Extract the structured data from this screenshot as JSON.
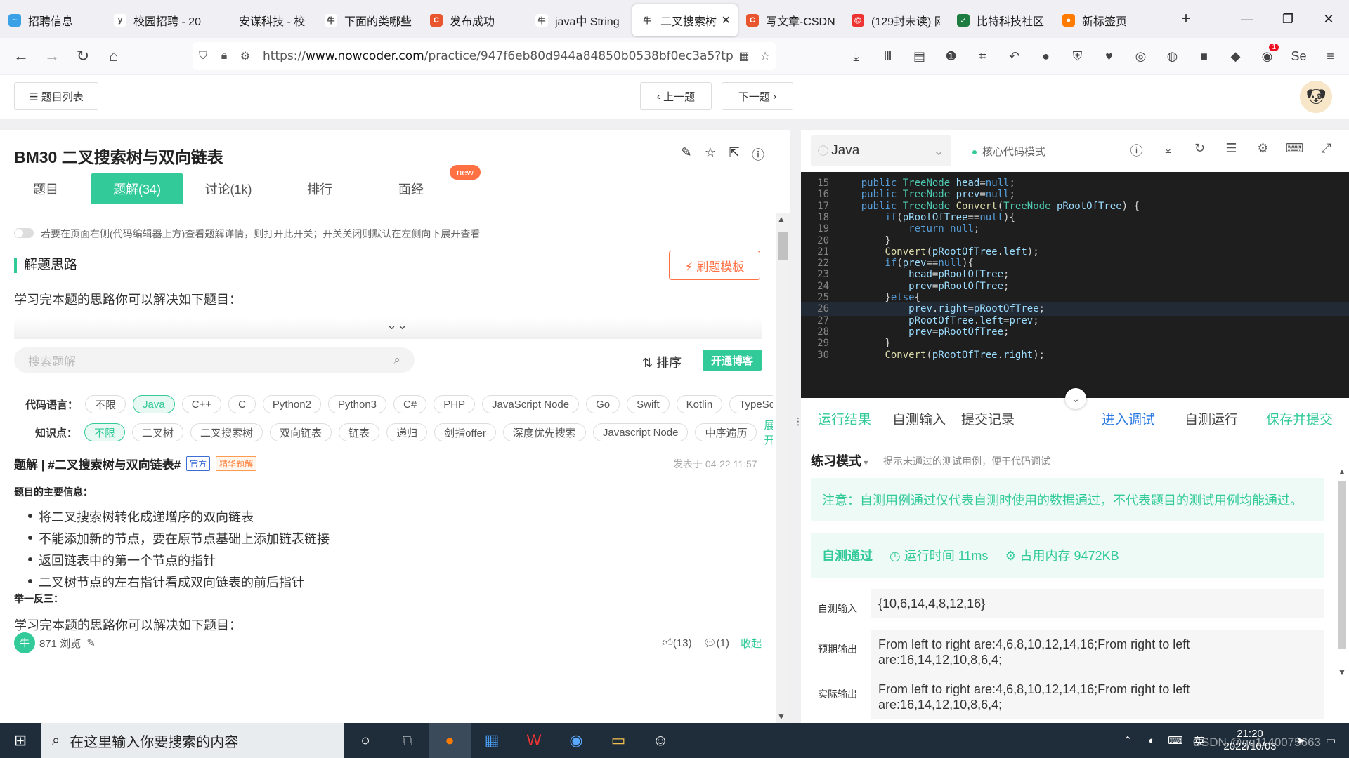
{
  "browser": {
    "tabs": [
      {
        "label": "招聘信息",
        "icon_color": "#3ba1e6",
        "icon": "~"
      },
      {
        "label": "校园招聘 - 20",
        "icon_color": "#ffffff",
        "icon": "y"
      },
      {
        "label": "安谋科技 - 校",
        "icon_color": "#f0f0f4",
        "icon": ""
      },
      {
        "label": "下面的类哪些",
        "icon_color": "#ffffff",
        "icon": "牛"
      },
      {
        "label": "发布成功",
        "icon_color": "#e8552e",
        "icon": "C"
      },
      {
        "label": "java中 String",
        "icon_color": "#ffffff",
        "icon": "牛"
      },
      {
        "label": "二叉搜索树",
        "icon_color": "#ffffff",
        "icon": "牛",
        "active": true
      },
      {
        "label": "写文章-CSDN",
        "icon_color": "#e8552e",
        "icon": "C"
      },
      {
        "label": "(129封未读) 网",
        "icon_color": "#e33",
        "icon": "@"
      },
      {
        "label": "比特科技社区",
        "icon_color": "#1d7c3f",
        "icon": "✓"
      },
      {
        "label": "新标签页",
        "icon_color": "#ff7a00",
        "icon": "●"
      }
    ],
    "new_tab_label": "+",
    "url_host": "www.nowcoder.com",
    "url_prefix": "https://",
    "url_path": "/practice/947f6eb80d944a84850b0538bf0ec3a5?tp"
  },
  "page_header": {
    "list_button": "☰ 题目列表",
    "prev_button": "上一题",
    "next_button": "下一题"
  },
  "problem": {
    "title": "BM30  二叉搜索树与双向链表",
    "tabs": [
      "题目",
      "题解(34)",
      "讨论(1k)",
      "排行",
      "面经"
    ],
    "new_badge": "new",
    "toggle_tip": "若要在页面右侧(代码编辑器上方)查看题解详情，则打开此开关；开关关闭则默认在左侧向下展开查看",
    "section_title": "解题思路",
    "template_button": "⚡ 刷题模板",
    "intro": "学习完本题的思路你可以解决如下题目：",
    "search_placeholder": "搜索题解",
    "sort_label": "⇅ 排序",
    "open_blog_button": "开通博客",
    "lang_label": "代码语言：",
    "langs": [
      "不限",
      "Java",
      "C++",
      "C",
      "Python2",
      "Python3",
      "C#",
      "PHP",
      "JavaScript Node",
      "Go",
      "Swift",
      "Kotlin",
      "TypeScript"
    ],
    "lang_selected": "Java",
    "topic_label": "知识点：",
    "topics": [
      "不限",
      "二叉树",
      "二叉搜索树",
      "双向链表",
      "链表",
      "递归",
      "剑指offer",
      "深度优先搜索",
      "Javascript Node",
      "中序遍历"
    ],
    "topic_selected": "不限",
    "expand_link": "展开",
    "solution_title": "题解 | #二叉搜索树与双向链表#",
    "tag_official": "官方",
    "tag_featured": "精华题解",
    "post_time": "发表于 04-22 11:57",
    "main_info_label": "题目的主要信息：",
    "bullets": [
      "将二叉搜索树转化成递增序的双向链表",
      "不能添加新的节点，要在原节点基础上添加链表链接",
      "返回链表中的第一个节点的指针",
      "二叉树节点的左右指针看成双向链表的前后指针"
    ],
    "infer_label": "举一反三：",
    "intro2": "学习完本题的思路你可以解决如下题目：",
    "views": "871 浏览",
    "likes": "(13)",
    "comments": "(1)",
    "collapse_link": "收起"
  },
  "editor": {
    "language": "Java",
    "mode": "核心代码模式",
    "lines": [
      {
        "n": 15,
        "html": "    <span class=\"kw\">public</span> <span class=\"ty\">TreeNode</span> <span class=\"id\">head</span>=<span class=\"kw\">null</span>;"
      },
      {
        "n": 16,
        "html": "    <span class=\"kw\">public</span> <span class=\"ty\">TreeNode</span> <span class=\"id\">prev</span>=<span class=\"kw\">null</span>;"
      },
      {
        "n": 17,
        "html": "    <span class=\"kw\">public</span> <span class=\"ty\">TreeNode</span> <span class=\"fn\">Convert</span>(<span class=\"ty\">TreeNode</span> <span class=\"id\">pRootOfTree</span>) {"
      },
      {
        "n": 18,
        "html": "        <span class=\"kw\">if</span>(<span class=\"id\">pRootOfTree</span>==<span class=\"kw\">null</span>){"
      },
      {
        "n": 19,
        "html": "            <span class=\"kw\">return</span> <span class=\"kw\">null</span>;"
      },
      {
        "n": 20,
        "html": "        }"
      },
      {
        "n": 21,
        "html": "        <span class=\"fn\">Convert</span>(<span class=\"id\">pRootOfTree</span>.<span class=\"id\">left</span>);"
      },
      {
        "n": 22,
        "html": "        <span class=\"kw\">if</span>(<span class=\"id\">prev</span>==<span class=\"kw\">null</span>){"
      },
      {
        "n": 23,
        "html": "            <span class=\"id\">head</span>=<span class=\"id\">pRootOfTree</span>;"
      },
      {
        "n": 24,
        "html": "            <span class=\"id\">prev</span>=<span class=\"id\">pRootOfTree</span>;"
      },
      {
        "n": 25,
        "html": "        }<span class=\"kw\">else</span>{"
      },
      {
        "n": 26,
        "html": "            <span class=\"id\">prev</span>.<span class=\"id\">right</span>=<span class=\"id\">pRootOfTree</span>;"
      },
      {
        "n": 27,
        "html": "            <span class=\"id\">pRootOfTree</span>.<span class=\"id\">left</span>=<span class=\"id\">prev</span>;"
      },
      {
        "n": 28,
        "html": "            <span class=\"id\">prev</span>=<span class=\"id\">pRootOfTree</span>;"
      },
      {
        "n": 29,
        "html": "        }"
      },
      {
        "n": 30,
        "html": "        <span class=\"fn\">Convert</span>(<span class=\"id\">pRootOfTree</span>.<span class=\"id\">right</span>);"
      }
    ],
    "current_line": 26
  },
  "result": {
    "tabs": {
      "run_result": "运行结果",
      "custom_input": "自测输入",
      "submit_records": "提交记录",
      "debug": "进入调试",
      "self_test": "自测运行",
      "save_submit": "保存并提交"
    },
    "practice_mode": "练习模式",
    "practice_tip": "提示未通过的测试用例，便于代码调试",
    "notice": "注意：自测用例通过仅代表自测时使用的数据通过，不代表题目的测试用例均能通过。",
    "status": "自测通过",
    "run_time": "运行时间 11ms",
    "memory": "占用内存 9472KB",
    "input_label": "自测输入",
    "input_value": "{10,6,14,4,8,12,16}",
    "expected_label": "预期输出",
    "expected_value": "From left to right are:4,6,8,10,12,14,16;From right to left are:16,14,12,10,8,6,4;",
    "actual_label": "实际输出",
    "actual_value": "From left to right are:4,6,8,10,12,14,16;From right to left are:16,14,12,10,8,6,4;"
  },
  "taskbar": {
    "search_placeholder": "在这里输入你要搜索的内容",
    "ime": "英",
    "time": "21:20",
    "date": "2022/10/03",
    "watermark": "CSDN @qq1140075663"
  }
}
